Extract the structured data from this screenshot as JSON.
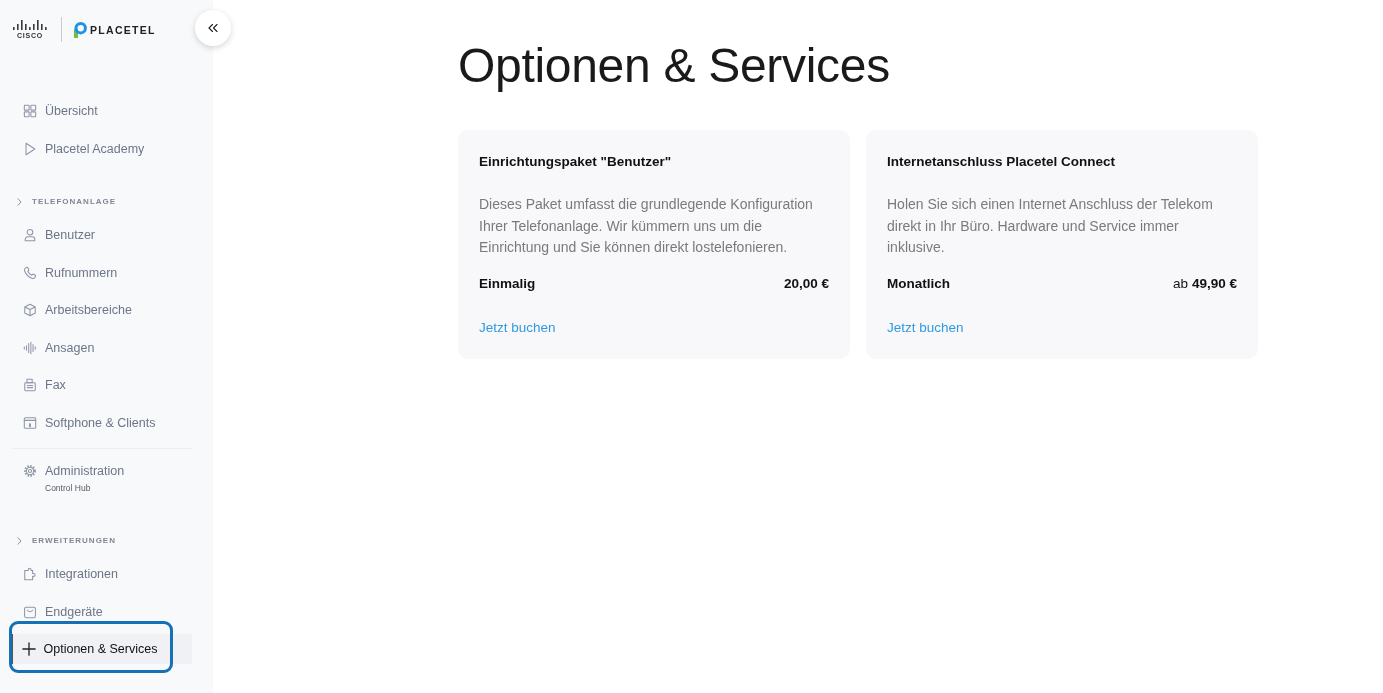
{
  "brand": {
    "partner": "CISCO",
    "product": "PLACETEL"
  },
  "sidebar": {
    "top_items": [
      {
        "label": "Übersicht",
        "selected": false,
        "highlighted": false
      },
      {
        "label": "Placetel Academy",
        "selected": false,
        "highlighted": false
      }
    ],
    "sections": [
      {
        "heading": "TELEFONANLAGE",
        "groups": [
          {
            "items": [
              {
                "label": "Benutzer",
                "selected": false,
                "highlighted": false
              },
              {
                "label": "Rufnummern",
                "selected": false,
                "highlighted": false
              },
              {
                "label": "Arbeitsbereiche",
                "selected": false,
                "highlighted": false
              },
              {
                "label": "Ansagen",
                "selected": false,
                "highlighted": false
              },
              {
                "label": "Fax",
                "selected": false,
                "highlighted": false
              },
              {
                "label": "Softphone & Clients",
                "selected": false,
                "highlighted": false
              }
            ]
          },
          {
            "items": [
              {
                "label": "Administration",
                "sublabel": "Control Hub",
                "selected": false,
                "highlighted": false
              }
            ]
          }
        ]
      },
      {
        "heading": "ERWEITERUNGEN",
        "groups": [
          {
            "items": [
              {
                "label": "Integrationen",
                "selected": false,
                "highlighted": false
              },
              {
                "label": "Endgeräte",
                "selected": false,
                "highlighted": false
              },
              {
                "label": "Optionen & Services",
                "selected": true,
                "highlighted": true
              }
            ]
          }
        ]
      }
    ]
  },
  "page_title": "Optionen & Services",
  "cards": [
    {
      "title": "Einrichtungspaket \"Benutzer\"",
      "description": "Dieses Paket umfasst die grundlegende Konfiguration Ihrer Telefonanlage. Wir kümmern uns um die Einrichtung und Sie können direkt lostelefonieren.",
      "billing": "Einmalig",
      "price": "20,00 €",
      "action": "Jetzt buchen"
    },
    {
      "title": "Internetanschluss Placetel Connect",
      "description": "Holen Sie sich einen Internet Anschluss der Telekom direkt in Ihr Büro. Hardware und Service immer inklusive.",
      "billing": "Monatlich",
      "price_prefix": "ab",
      "price": "49,90 €",
      "action": "Jetzt buchen"
    }
  ]
}
